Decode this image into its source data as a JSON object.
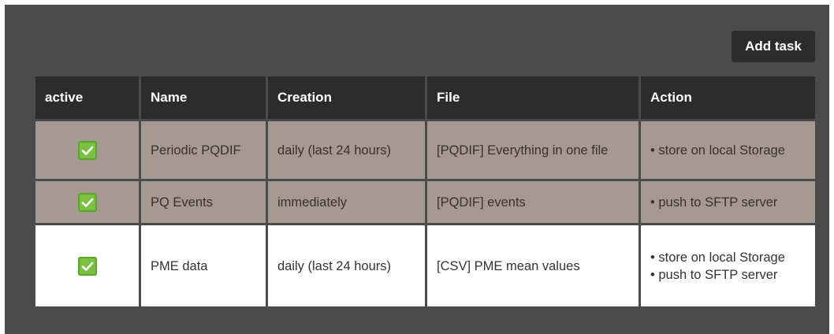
{
  "toolbar": {
    "add_task_label": "Add task"
  },
  "table": {
    "headers": [
      "active",
      "Name",
      "Creation",
      "File",
      "Action"
    ],
    "rows": [
      {
        "active": true,
        "name": "Periodic PQDIF",
        "creation": "daily (last 24 hours)",
        "file": "[PQDIF] Everything in one file",
        "actions": [
          "• store on local Storage"
        ],
        "highlighted": true
      },
      {
        "active": true,
        "name": "PQ Events",
        "creation": "immediately",
        "file": "[PQDIF] events",
        "actions": [
          "• push to SFTP server"
        ],
        "highlighted": true
      },
      {
        "active": true,
        "name": "PME data",
        "creation": "daily (last 24 hours)",
        "file": "[CSV] PME mean values",
        "actions": [
          "• store on local Storage",
          "• push to SFTP server"
        ],
        "highlighted": false
      }
    ]
  },
  "colors": {
    "panel_bg": "#4b4b4b",
    "header_bg": "#2c2c2c",
    "highlight_row_bg": "#a69893",
    "checkbox_green": "#7cc043"
  },
  "icons": {
    "checkbox": "checkbox-checked-icon"
  }
}
